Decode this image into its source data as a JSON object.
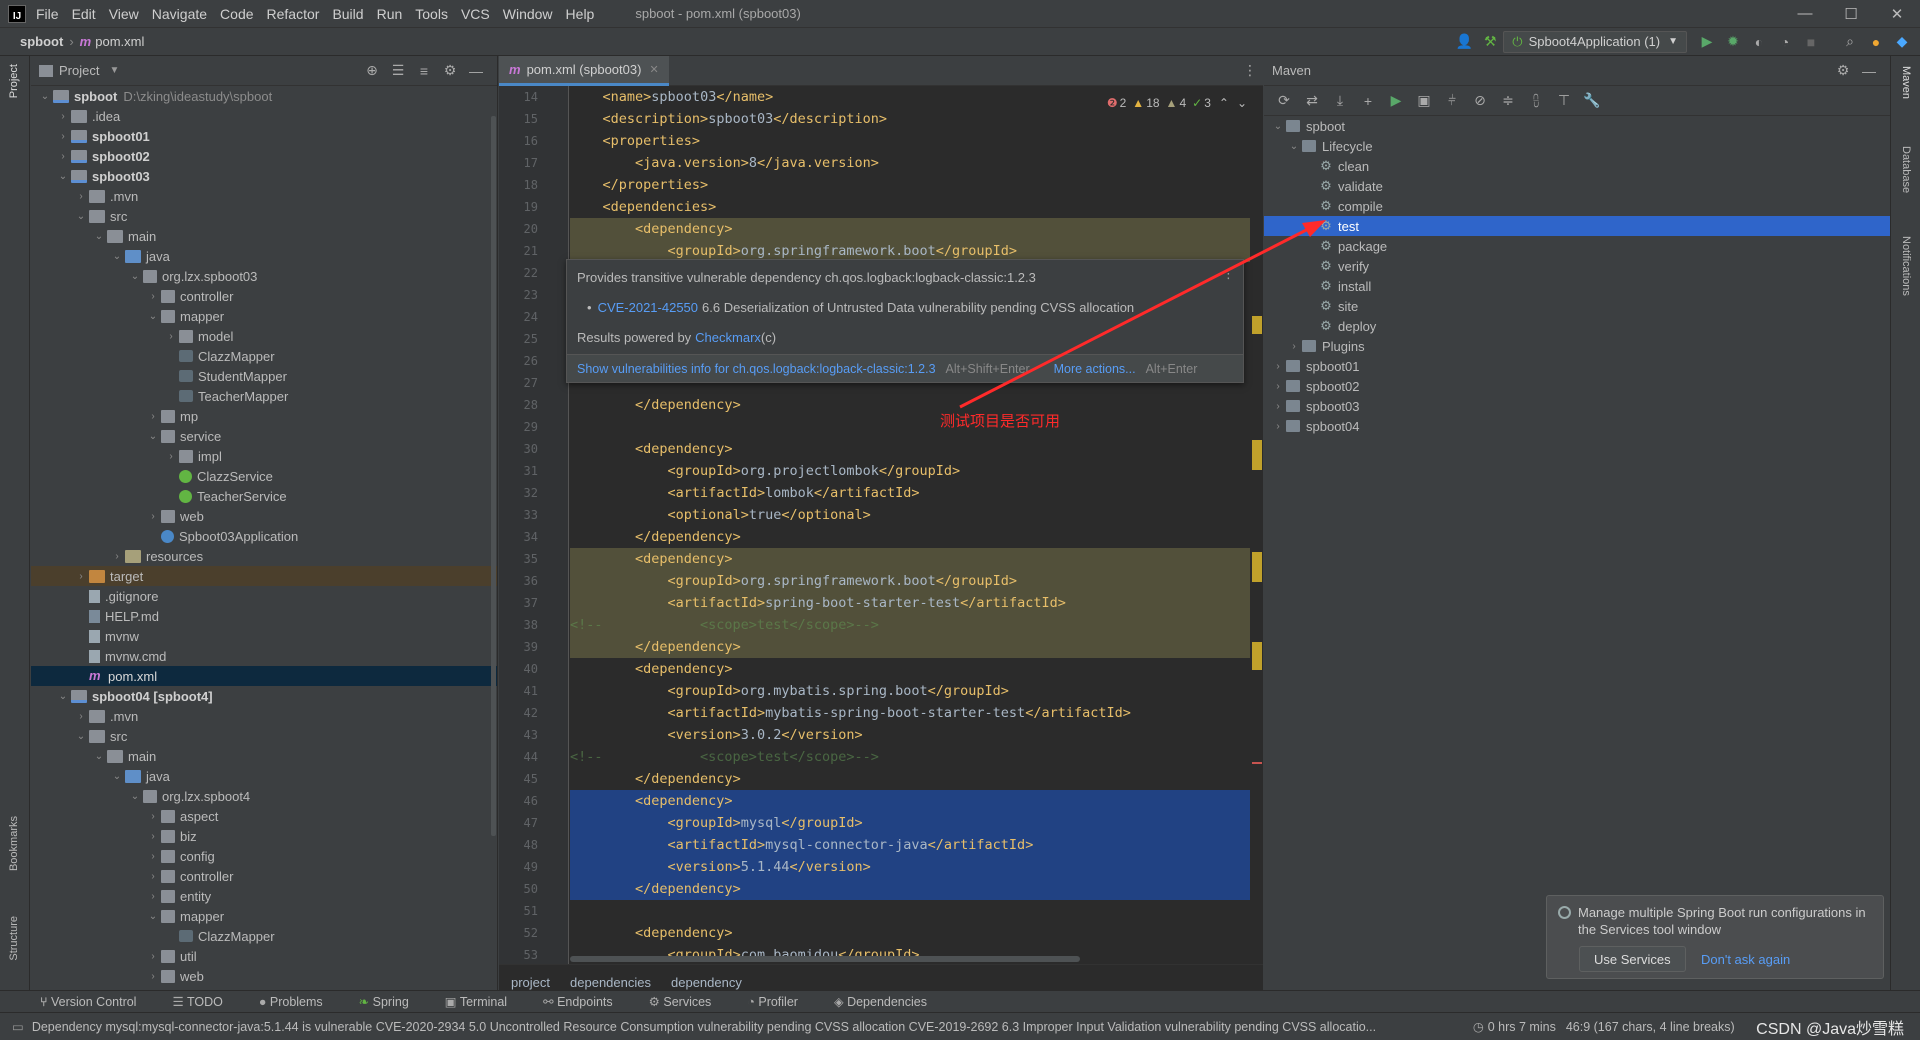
{
  "window": {
    "title": "spboot - pom.xml (spboot03)",
    "menu": [
      "File",
      "Edit",
      "View",
      "Navigate",
      "Code",
      "Refactor",
      "Build",
      "Run",
      "Tools",
      "VCS",
      "Window",
      "Help"
    ],
    "controls": [
      "—",
      "☐",
      "✕"
    ]
  },
  "navbar": {
    "project": "spboot",
    "file": "pom.xml",
    "run_config": "Spboot4Application (1)"
  },
  "left_stripe": {
    "project": "Project",
    "bookmarks": "Bookmarks",
    "structure": "Structure"
  },
  "right_stripe": {
    "maven": "Maven",
    "database": "Database",
    "notifications": "Notifications"
  },
  "project_panel": {
    "title": "Project",
    "tree": [
      {
        "indent": 0,
        "arrow": "⌄",
        "icon": "modfolder",
        "label": "spboot",
        "bold": true,
        "path": "D:\\zking\\ideastudy\\spboot"
      },
      {
        "indent": 1,
        "arrow": "›",
        "icon": "folder",
        "label": ".idea"
      },
      {
        "indent": 1,
        "arrow": "›",
        "icon": "modfolder",
        "label": "spboot01",
        "bold": true
      },
      {
        "indent": 1,
        "arrow": "›",
        "icon": "modfolder",
        "label": "spboot02",
        "bold": true
      },
      {
        "indent": 1,
        "arrow": "⌄",
        "icon": "modfolder",
        "label": "spboot03",
        "bold": true
      },
      {
        "indent": 2,
        "arrow": "›",
        "icon": "folder",
        "label": ".mvn"
      },
      {
        "indent": 2,
        "arrow": "⌄",
        "icon": "folder",
        "label": "src"
      },
      {
        "indent": 3,
        "arrow": "⌄",
        "icon": "folder",
        "label": "main"
      },
      {
        "indent": 4,
        "arrow": "⌄",
        "icon": "srcfolder",
        "label": "java"
      },
      {
        "indent": 5,
        "arrow": "⌄",
        "icon": "pkg",
        "label": "org.lzx.spboot03"
      },
      {
        "indent": 6,
        "arrow": "›",
        "icon": "pkg",
        "label": "controller"
      },
      {
        "indent": 6,
        "arrow": "⌄",
        "icon": "pkg",
        "label": "mapper"
      },
      {
        "indent": 7,
        "arrow": "›",
        "icon": "pkg",
        "label": "model"
      },
      {
        "indent": 7,
        "arrow": "",
        "icon": "iface",
        "label": "ClazzMapper"
      },
      {
        "indent": 7,
        "arrow": "",
        "icon": "iface",
        "label": "StudentMapper"
      },
      {
        "indent": 7,
        "arrow": "",
        "icon": "iface",
        "label": "TeacherMapper"
      },
      {
        "indent": 6,
        "arrow": "›",
        "icon": "pkg",
        "label": "mp"
      },
      {
        "indent": 6,
        "arrow": "⌄",
        "icon": "pkg",
        "label": "service"
      },
      {
        "indent": 7,
        "arrow": "›",
        "icon": "pkg",
        "label": "impl"
      },
      {
        "indent": 7,
        "arrow": "",
        "icon": "springcls",
        "label": "ClazzService"
      },
      {
        "indent": 7,
        "arrow": "",
        "icon": "springcls",
        "label": "TeacherService"
      },
      {
        "indent": 6,
        "arrow": "›",
        "icon": "pkg",
        "label": "web"
      },
      {
        "indent": 6,
        "arrow": "",
        "icon": "appcls",
        "label": "Spboot03Application"
      },
      {
        "indent": 4,
        "arrow": "›",
        "icon": "resfolder",
        "label": "resources"
      },
      {
        "indent": 2,
        "arrow": "›",
        "icon": "targetfolder",
        "label": "target",
        "rowclass": "target"
      },
      {
        "indent": 2,
        "arrow": "",
        "icon": "file",
        "label": ".gitignore"
      },
      {
        "indent": 2,
        "arrow": "",
        "icon": "md",
        "label": "HELP.md"
      },
      {
        "indent": 2,
        "arrow": "",
        "icon": "file",
        "label": "mvnw"
      },
      {
        "indent": 2,
        "arrow": "",
        "icon": "file",
        "label": "mvnw.cmd"
      },
      {
        "indent": 2,
        "arrow": "",
        "icon": "mvn",
        "label": "pom.xml",
        "rowclass": "sel"
      },
      {
        "indent": 1,
        "arrow": "⌄",
        "icon": "modfolder",
        "label": "spboot04 [spboot4]",
        "bold": true
      },
      {
        "indent": 2,
        "arrow": "›",
        "icon": "folder",
        "label": ".mvn"
      },
      {
        "indent": 2,
        "arrow": "⌄",
        "icon": "folder",
        "label": "src"
      },
      {
        "indent": 3,
        "arrow": "⌄",
        "icon": "folder",
        "label": "main"
      },
      {
        "indent": 4,
        "arrow": "⌄",
        "icon": "srcfolder",
        "label": "java"
      },
      {
        "indent": 5,
        "arrow": "⌄",
        "icon": "pkg",
        "label": "org.lzx.spboot4"
      },
      {
        "indent": 6,
        "arrow": "›",
        "icon": "pkg",
        "label": "aspect"
      },
      {
        "indent": 6,
        "arrow": "›",
        "icon": "pkg",
        "label": "biz"
      },
      {
        "indent": 6,
        "arrow": "›",
        "icon": "pkg",
        "label": "config"
      },
      {
        "indent": 6,
        "arrow": "›",
        "icon": "pkg",
        "label": "controller"
      },
      {
        "indent": 6,
        "arrow": "›",
        "icon": "pkg",
        "label": "entity"
      },
      {
        "indent": 6,
        "arrow": "⌄",
        "icon": "pkg",
        "label": "mapper"
      },
      {
        "indent": 7,
        "arrow": "",
        "icon": "iface",
        "label": "ClazzMapper"
      },
      {
        "indent": 6,
        "arrow": "›",
        "icon": "pkg",
        "label": "util"
      },
      {
        "indent": 6,
        "arrow": "›",
        "icon": "pkg",
        "label": "web"
      }
    ]
  },
  "editor": {
    "tab": "pom.xml (spboot03)",
    "inspection": {
      "errors": "2",
      "warnings": "18",
      "weak": "4",
      "ok": "3"
    },
    "lines": [
      {
        "n": "14",
        "html": "    <span class='tag'>&lt;name&gt;</span>spboot03<span class='tag'>&lt;/name&gt;</span>"
      },
      {
        "n": "15",
        "html": "    <span class='tag'>&lt;description&gt;</span>spboot03<span class='tag'>&lt;/description&gt;</span>"
      },
      {
        "n": "16",
        "html": "    <span class='tag'>&lt;properties&gt;</span>"
      },
      {
        "n": "17",
        "html": "        <span class='tag'>&lt;java.version&gt;</span>8<span class='tag'>&lt;/java.version&gt;</span>"
      },
      {
        "n": "18",
        "html": "    <span class='tag'>&lt;/properties&gt;</span>"
      },
      {
        "n": "19",
        "html": "    <span class='tag'>&lt;dependencies&gt;</span>"
      },
      {
        "n": "20",
        "cls": "hl-warn",
        "html": "        <span class='tag'>&lt;dependency&gt;</span>"
      },
      {
        "n": "21",
        "cls": "hl-warn",
        "html": "            <span class='tag'>&lt;groupId&gt;</span>org.springframework.boot<span class='tag'>&lt;/groupId&gt;</span>"
      },
      {
        "n": "22",
        "html": ""
      },
      {
        "n": "23",
        "html": ""
      },
      {
        "n": "24",
        "html": ""
      },
      {
        "n": "25",
        "html": ""
      },
      {
        "n": "26",
        "html": ""
      },
      {
        "n": "27",
        "html": ""
      },
      {
        "n": "28",
        "html": "        <span class='tag'>&lt;/dependency&gt;</span>"
      },
      {
        "n": "29",
        "html": ""
      },
      {
        "n": "30",
        "html": "        <span class='tag'>&lt;dependency&gt;</span>"
      },
      {
        "n": "31",
        "html": "            <span class='tag'>&lt;groupId&gt;</span>org.projectlombok<span class='tag'>&lt;/groupId&gt;</span>"
      },
      {
        "n": "32",
        "html": "            <span class='tag'>&lt;artifactId&gt;</span>lombok<span class='tag'>&lt;/artifactId&gt;</span>"
      },
      {
        "n": "33",
        "html": "            <span class='tag'>&lt;optional&gt;</span>true<span class='tag'>&lt;/optional&gt;</span>"
      },
      {
        "n": "34",
        "html": "        <span class='tag'>&lt;/dependency&gt;</span>"
      },
      {
        "n": "35",
        "cls": "hl-warn",
        "html": "        <span class='tag'>&lt;dependency&gt;</span>"
      },
      {
        "n": "36",
        "cls": "hl-warn",
        "html": "            <span class='tag'>&lt;groupId&gt;</span>org.springframework.boot<span class='tag'>&lt;/groupId&gt;</span>"
      },
      {
        "n": "37",
        "cls": "hl-warn",
        "html": "            <span class='tag'>&lt;artifactId&gt;</span>spring-boot-starter-test<span class='tag'>&lt;/artifactId&gt;</span>"
      },
      {
        "n": "38",
        "cls": "hl-warn",
        "html": "<span class='comment'>&lt;!--            &lt;scope&gt;test&lt;/scope&gt;--&gt;</span>"
      },
      {
        "n": "39",
        "cls": "hl-warn",
        "html": "        <span class='tag'>&lt;/dependency&gt;</span>"
      },
      {
        "n": "40",
        "html": "        <span class='tag'>&lt;dependency&gt;</span>"
      },
      {
        "n": "41",
        "html": "            <span class='tag'>&lt;groupId&gt;</span>org.mybatis.spring.boot<span class='tag'>&lt;/groupId&gt;</span>"
      },
      {
        "n": "42",
        "html": "            <span class='tag'>&lt;artifactId&gt;</span>mybatis-spring-boot-starter-test<span class='tag'>&lt;/artifactId&gt;</span>"
      },
      {
        "n": "43",
        "html": "            <span class='tag'>&lt;version&gt;</span>3.0.2<span class='tag'>&lt;/version&gt;</span>"
      },
      {
        "n": "44",
        "html": "<span class='comment'>&lt;!--            &lt;scope&gt;test&lt;/scope&gt;--&gt;</span>"
      },
      {
        "n": "45",
        "html": "        <span class='tag'>&lt;/dependency&gt;</span>"
      },
      {
        "n": "46",
        "cls": "hl-sel",
        "html": "        <span class='tag'>&lt;dependency&gt;</span>"
      },
      {
        "n": "47",
        "cls": "hl-sel",
        "html": "            <span class='tag'>&lt;groupId&gt;</span>mysql<span class='tag'>&lt;/groupId&gt;</span>"
      },
      {
        "n": "48",
        "cls": "hl-sel",
        "html": "            <span class='tag'>&lt;artifactId&gt;</span>mysql-connector-java<span class='tag'>&lt;/artifactId&gt;</span>"
      },
      {
        "n": "49",
        "cls": "hl-sel",
        "html": "            <span class='tag'>&lt;version&gt;</span>5.1.44<span class='tag'>&lt;/version&gt;</span>"
      },
      {
        "n": "50",
        "cls": "hl-sel",
        "html": "        <span class='tag'>&lt;/dependency&gt;</span>"
      },
      {
        "n": "51",
        "html": ""
      },
      {
        "n": "52",
        "html": "        <span class='tag'>&lt;dependency&gt;</span>"
      },
      {
        "n": "53",
        "html": "            <span class='tag'>&lt;groupId&gt;</span>com.baomidou<span class='tag'>&lt;/groupId&gt;</span>"
      }
    ],
    "breadcrumbs": [
      "project",
      "dependencies",
      "dependency"
    ]
  },
  "popup": {
    "line1": "Provides transitive vulnerable dependency ch.qos.logback:logback-classic:1.2.3",
    "cve": "CVE-2021-42550",
    "cve_desc": "6.6 Deserialization of Untrusted Data vulnerability pending CVSS allocation",
    "powered": "Results powered by",
    "checkmarx": "Checkmarx",
    "checkmarx_suffix": "(c)",
    "show_info": "Show vulnerabilities info for ch.qos.logback:logback-classic:1.2.3",
    "show_info_key": "Alt+Shift+Enter",
    "more_actions": "More actions...",
    "more_actions_key": "Alt+Enter"
  },
  "maven": {
    "title": "Maven",
    "tree": [
      {
        "indent": 0,
        "arrow": "⌄",
        "kind": "proj",
        "label": "spboot"
      },
      {
        "indent": 1,
        "arrow": "⌄",
        "kind": "folder",
        "label": "Lifecycle"
      },
      {
        "indent": 2,
        "arrow": "",
        "kind": "gear",
        "label": "clean"
      },
      {
        "indent": 2,
        "arrow": "",
        "kind": "gear",
        "label": "validate"
      },
      {
        "indent": 2,
        "arrow": "",
        "kind": "gear",
        "label": "compile"
      },
      {
        "indent": 2,
        "arrow": "",
        "kind": "gear",
        "label": "test",
        "sel": true
      },
      {
        "indent": 2,
        "arrow": "",
        "kind": "gear",
        "label": "package"
      },
      {
        "indent": 2,
        "arrow": "",
        "kind": "gear",
        "label": "verify"
      },
      {
        "indent": 2,
        "arrow": "",
        "kind": "gear",
        "label": "install"
      },
      {
        "indent": 2,
        "arrow": "",
        "kind": "gear",
        "label": "site"
      },
      {
        "indent": 2,
        "arrow": "",
        "kind": "gear",
        "label": "deploy"
      },
      {
        "indent": 1,
        "arrow": "›",
        "kind": "folder",
        "label": "Plugins"
      },
      {
        "indent": 0,
        "arrow": "›",
        "kind": "proj",
        "label": "spboot01"
      },
      {
        "indent": 0,
        "arrow": "›",
        "kind": "proj",
        "label": "spboot02"
      },
      {
        "indent": 0,
        "arrow": "›",
        "kind": "proj",
        "label": "spboot03"
      },
      {
        "indent": 0,
        "arrow": "›",
        "kind": "proj",
        "label": "spboot04"
      }
    ]
  },
  "annotation": {
    "text": "测试项目是否可用",
    "color": "#ff2a2a"
  },
  "notification": {
    "message": "Manage multiple Spring Boot run configurations in the Services tool window",
    "use_services": "Use Services",
    "dont_ask": "Don't ask again"
  },
  "toolwindows": [
    "Version Control",
    "TODO",
    "Problems",
    "Spring",
    "Terminal",
    "Endpoints",
    "Services",
    "Profiler",
    "Dependencies"
  ],
  "status": {
    "message": "Dependency mysql:mysql-connector-java:5.1.44 is vulnerable CVE-2020-2934 5.0 Uncontrolled Resource Consumption vulnerability pending CVSS allocation CVE-2019-2692 6.3 Improper Input Validation vulnerability pending CVSS allocatio...",
    "time": "0 hrs 7 mins",
    "position": "46:9 (167 chars, 4 line breaks)",
    "watermark": "CSDN @Java炒雪糕"
  }
}
